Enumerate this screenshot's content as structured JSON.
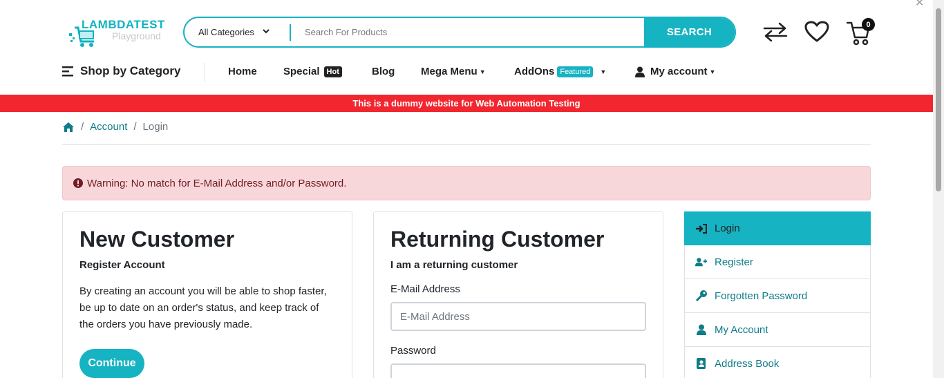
{
  "logo": {
    "title": "LAMBDATEST",
    "subtitle": "Playground"
  },
  "search": {
    "category": "All Categories",
    "placeholder": "Search For Products",
    "button": "SEARCH"
  },
  "cart": {
    "count": "0"
  },
  "nav": {
    "shop_by_category": "Shop by Category",
    "items": [
      {
        "label": "Home"
      },
      {
        "label": "Special",
        "badge": "Hot"
      },
      {
        "label": "Blog"
      },
      {
        "label": "Mega Menu"
      },
      {
        "label": "AddOns",
        "badge": "Featured"
      },
      {
        "label": "My account"
      }
    ]
  },
  "banner": "This is a dummy website for Web Automation Testing",
  "breadcrumb": {
    "account": "Account",
    "current": "Login"
  },
  "alert": "Warning: No match for E-Mail Address and/or Password.",
  "new_customer": {
    "title": "New Customer",
    "subtitle": "Register Account",
    "text": "By creating an account you will be able to shop faster, be up to date on an order's status, and keep track of the orders you have previously made.",
    "button": "Continue"
  },
  "returning_customer": {
    "title": "Returning Customer",
    "subtitle": "I am a returning customer",
    "email_label": "E-Mail Address",
    "email_placeholder": "E-Mail Address",
    "password_label": "Password"
  },
  "side_menu": [
    {
      "label": "Login",
      "icon": "sign-in-icon",
      "active": true
    },
    {
      "label": "Register",
      "icon": "user-plus-icon"
    },
    {
      "label": "Forgotten Password",
      "icon": "key-icon"
    },
    {
      "label": "My Account",
      "icon": "user-icon"
    },
    {
      "label": "Address Book",
      "icon": "address-book-icon"
    }
  ],
  "colors": {
    "accent": "#16b3c2",
    "banner": "#f2262f",
    "link": "#0f7c88",
    "alert_bg": "#f8d7da",
    "alert_text": "#721c24"
  }
}
